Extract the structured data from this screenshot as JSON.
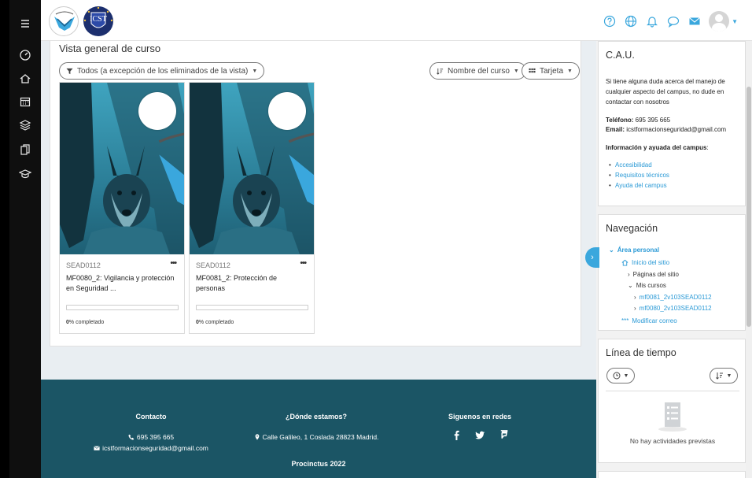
{
  "colors": {
    "accent": "#3aa7dd",
    "footer_bg": "#1b5565",
    "rail_bg": "#0f0f0f"
  },
  "rail": {
    "items": [
      {
        "name": "menu-icon"
      },
      {
        "name": "dashboard-icon"
      },
      {
        "name": "home-icon"
      },
      {
        "name": "calendar-icon"
      },
      {
        "name": "stack-icon"
      },
      {
        "name": "files-icon"
      },
      {
        "name": "graduation-icon"
      }
    ]
  },
  "topbar": {
    "logo_b_text": "ICST",
    "icons": [
      "help-icon",
      "globe-icon",
      "bell-icon",
      "chat-icon",
      "mail-icon"
    ]
  },
  "main": {
    "title": "Vista general de curso",
    "filter_label": "Todos (a excepción de los eliminados de la vista)",
    "sort_label": "Nombre del curso",
    "view_label": "Tarjeta",
    "courses": [
      {
        "code": "SEAD0112",
        "name": "MF0080_2: Vigilancia y protección en Seguridad ...",
        "progress_pct": 0,
        "progress_value": "0",
        "progress_suffix": "% completado"
      },
      {
        "code": "SEAD0112",
        "name": "MF0081_2: Protección de personas",
        "progress_pct": 0,
        "progress_value": "0",
        "progress_suffix": "% completado"
      }
    ],
    "more_label": "•••"
  },
  "footer": {
    "contact_head": "Contacto",
    "phone": "695 395 665",
    "email": "icstformacionseguridad@gmail.com",
    "where_head": "¿Dónde estamos?",
    "address": "Calle Galileo, 1 Coslada 28823 Madrid.",
    "social_head": "Siguenos en redes",
    "copyright": "Procinctus 2022"
  },
  "blocks": {
    "cau": {
      "title": "C.A.U.",
      "intro": "Si tiene alguna duda acerca del manejo de cualquier aspecto del campus, no dude en contactar con nosotros",
      "phone_label": "Teléfono:",
      "phone": " 695 395 665",
      "email_label": "Email:",
      "email": " icstformacionseguridad@gmail.com",
      "info_label": "Información y ayuada del campus",
      "info_colon": ":",
      "links": [
        "Accesibilidad",
        "Requisitos técnicos",
        "Ayuda del campus"
      ]
    },
    "nav": {
      "title": "Navegación",
      "area": "Área personal",
      "home": "Inicio del sitio",
      "pages": "Páginas del sitio",
      "my_courses": "Mis cursos",
      "course1": "mf0081_2v103SEAD0112",
      "course2": "mf0080_2v103SEAD0112",
      "edit_mail": "Modificar correo"
    },
    "timeline": {
      "title": "Línea de tiempo",
      "empty": "No hay actividades previstas"
    }
  }
}
